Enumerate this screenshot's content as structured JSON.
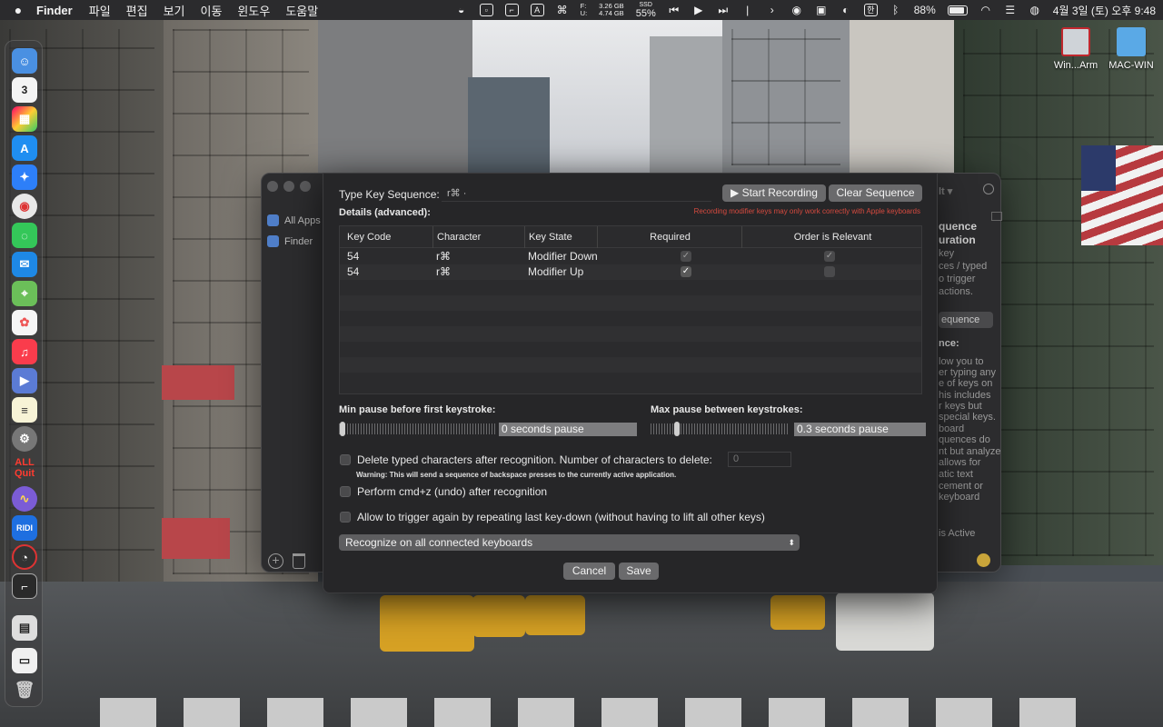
{
  "menubar": {
    "app_name": "Finder",
    "menus": [
      "파일",
      "편집",
      "보기",
      "이동",
      "윈도우",
      "도움말"
    ],
    "status": {
      "disk_free": "3.26 GB",
      "disk_used": "4.74 GB",
      "disk_labels": [
        "F:",
        "U:"
      ],
      "ssd_label": "SSD",
      "ssd_percent": "55%",
      "battery_percent": "88%",
      "ime": "한",
      "datetime": "4월 3일 (토) 오후 9:48"
    }
  },
  "dock": {
    "calendar_day": "3",
    "quit_label_top": "ALL",
    "quit_label_bottom": "Quit",
    "ridi_label": "RIDI"
  },
  "desktop": {
    "icons": [
      {
        "label": "Win...Arm"
      },
      {
        "label": "MAC-WIN"
      }
    ]
  },
  "background_window": {
    "sidebar": [
      {
        "label": "All Apps"
      },
      {
        "label": "Finder"
      }
    ],
    "right_panel": {
      "top_fragment": "lt ▾",
      "line1": "quence",
      "line2": "uration",
      "desc": [
        "key",
        "ces / typed",
        "o trigger",
        "actions."
      ],
      "button": "equence",
      "section": "nce:",
      "body": [
        "low you to",
        "er typing any",
        "e of keys on",
        "his includes",
        "r keys but",
        "special keys.",
        "board",
        "quences do",
        "nt but analyze",
        "allows for",
        "atic text",
        "cement or",
        "keyboard"
      ],
      "status": "is Active"
    }
  },
  "dialog": {
    "type_key_label": "Type Key Sequence:",
    "sequence_value": "r⌘ ·",
    "start_recording": "▶ Start Recording",
    "clear_sequence": "Clear Sequence",
    "details_label": "Details (advanced):",
    "recording_warning": "Recording modifier keys may only work correctly with Apple keyboards",
    "table": {
      "columns": [
        "Key Code",
        "Character",
        "Key State",
        "Required",
        "Order is Relevant"
      ],
      "rows": [
        {
          "key_code": "54",
          "character": "r⌘",
          "key_state": "Modifier Down",
          "required": true,
          "order_relevant": true
        },
        {
          "key_code": "54",
          "character": "r⌘",
          "key_state": "Modifier Up",
          "required": true,
          "order_relevant": false
        }
      ]
    },
    "min_pause_label": "Min pause before first keystroke:",
    "min_pause_value": "0 seconds pause",
    "min_pause_level": 0.0,
    "max_pause_label": "Max pause between keystrokes:",
    "max_pause_value": "0.3 seconds pause",
    "max_pause_level": 0.17,
    "delete_chars_label": "Delete typed characters after recognition. Number of characters to delete:",
    "delete_chars_placeholder": "0",
    "delete_chars_checked": false,
    "delete_warning": "Warning: This will send a sequence of backspace presses to the currently active application.",
    "undo_label": "Perform cmd+z (undo) after recognition",
    "undo_checked": false,
    "retrigger_label": "Allow to trigger again by repeating last key-down (without having to lift all other keys)",
    "retrigger_checked": false,
    "keyboard_select": "Recognize on all connected keyboards",
    "cancel": "Cancel",
    "save": "Save"
  }
}
